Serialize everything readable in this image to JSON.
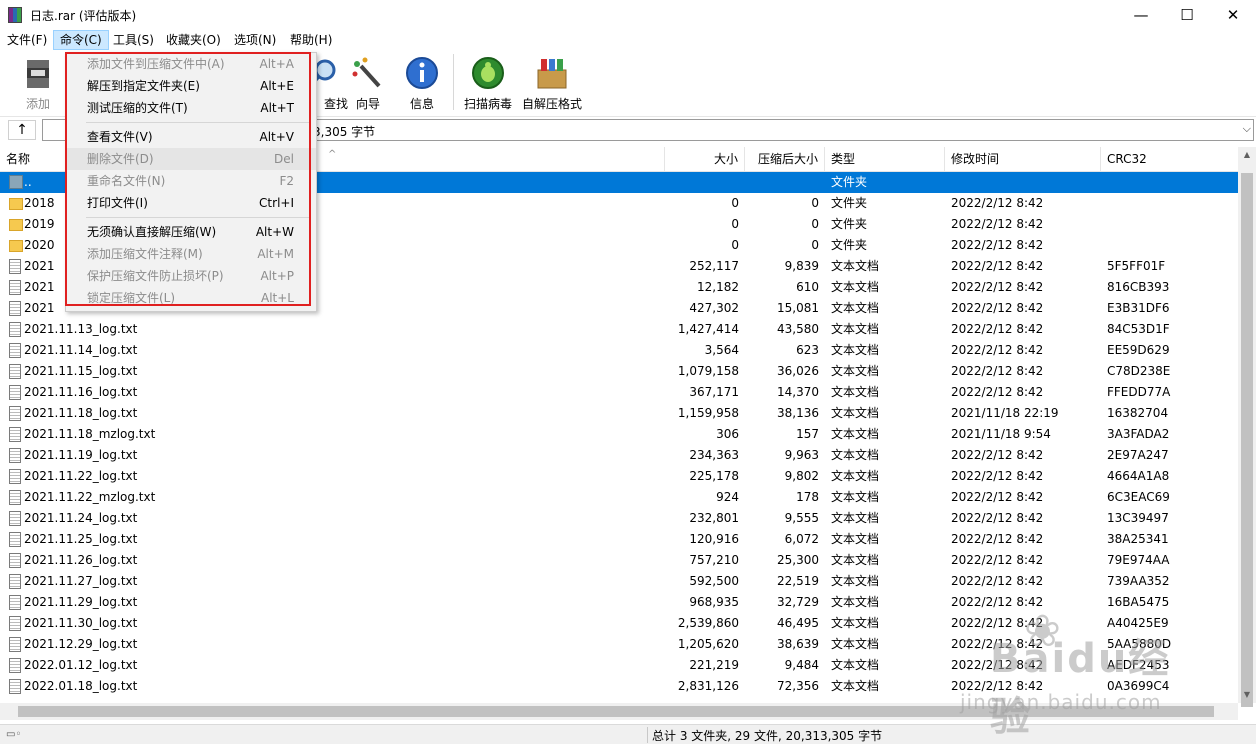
{
  "window": {
    "title": "日志.rar (评估版本)",
    "minimize": "—",
    "maximize": "☐",
    "close": "✕"
  },
  "menubar": {
    "items": [
      "文件(F)",
      "命令(C)",
      "工具(S)",
      "收藏夹(O)",
      "选项(N)",
      "帮助(H)"
    ],
    "active_index": 1
  },
  "toolbar": {
    "items": [
      {
        "label": "添加",
        "icon": "add-archive-icon"
      },
      {
        "label": "查找",
        "icon": "find-icon"
      },
      {
        "label": "向导",
        "icon": "wizard-icon"
      },
      {
        "label": "信息",
        "icon": "info-icon"
      },
      {
        "label": "扫描病毒",
        "icon": "virus-scan-icon"
      },
      {
        "label": "自解压格式",
        "icon": "sfx-icon"
      }
    ]
  },
  "addressbar": {
    "up": "↑",
    "path_fragment": "3,305 字节"
  },
  "list": {
    "columns": {
      "name": "名称",
      "size": "大小",
      "packed": "压缩后大小",
      "type": "类型",
      "modified": "修改时间",
      "crc": "CRC32"
    },
    "rows": [
      {
        "icon": "parent",
        "name": "..",
        "size": "",
        "packed": "",
        "type": "文件夹",
        "modified": "",
        "crc": ""
      },
      {
        "icon": "folder",
        "name": "2018",
        "size": "0",
        "packed": "0",
        "type": "文件夹",
        "modified": "2022/2/12 8:42",
        "crc": ""
      },
      {
        "icon": "folder",
        "name": "2019",
        "size": "0",
        "packed": "0",
        "type": "文件夹",
        "modified": "2022/2/12 8:42",
        "crc": ""
      },
      {
        "icon": "folder",
        "name": "2020",
        "size": "0",
        "packed": "0",
        "type": "文件夹",
        "modified": "2022/2/12 8:42",
        "crc": ""
      },
      {
        "icon": "txt",
        "name": "2021",
        "size": "252,117",
        "packed": "9,839",
        "type": "文本文档",
        "modified": "2022/2/12 8:42",
        "crc": "5F5FF01F"
      },
      {
        "icon": "txt",
        "name": "2021",
        "size": "12,182",
        "packed": "610",
        "type": "文本文档",
        "modified": "2022/2/12 8:42",
        "crc": "816CB393"
      },
      {
        "icon": "txt",
        "name": "2021",
        "size": "427,302",
        "packed": "15,081",
        "type": "文本文档",
        "modified": "2022/2/12 8:42",
        "crc": "E3B31DF6"
      },
      {
        "icon": "txt",
        "name": "2021.11.13_log.txt",
        "size": "1,427,414",
        "packed": "43,580",
        "type": "文本文档",
        "modified": "2022/2/12 8:42",
        "crc": "84C53D1F"
      },
      {
        "icon": "txt",
        "name": "2021.11.14_log.txt",
        "size": "3,564",
        "packed": "623",
        "type": "文本文档",
        "modified": "2022/2/12 8:42",
        "crc": "EE59D629"
      },
      {
        "icon": "txt",
        "name": "2021.11.15_log.txt",
        "size": "1,079,158",
        "packed": "36,026",
        "type": "文本文档",
        "modified": "2022/2/12 8:42",
        "crc": "C78D238E"
      },
      {
        "icon": "txt",
        "name": "2021.11.16_log.txt",
        "size": "367,171",
        "packed": "14,370",
        "type": "文本文档",
        "modified": "2022/2/12 8:42",
        "crc": "FFEDD77A"
      },
      {
        "icon": "txt",
        "name": "2021.11.18_log.txt",
        "size": "1,159,958",
        "packed": "38,136",
        "type": "文本文档",
        "modified": "2021/11/18 22:19",
        "crc": "16382704"
      },
      {
        "icon": "txt",
        "name": "2021.11.18_mzlog.txt",
        "size": "306",
        "packed": "157",
        "type": "文本文档",
        "modified": "2021/11/18 9:54",
        "crc": "3A3FADA2"
      },
      {
        "icon": "txt",
        "name": "2021.11.19_log.txt",
        "size": "234,363",
        "packed": "9,963",
        "type": "文本文档",
        "modified": "2022/2/12 8:42",
        "crc": "2E97A247"
      },
      {
        "icon": "txt",
        "name": "2021.11.22_log.txt",
        "size": "225,178",
        "packed": "9,802",
        "type": "文本文档",
        "modified": "2022/2/12 8:42",
        "crc": "4664A1A8"
      },
      {
        "icon": "txt",
        "name": "2021.11.22_mzlog.txt",
        "size": "924",
        "packed": "178",
        "type": "文本文档",
        "modified": "2022/2/12 8:42",
        "crc": "6C3EAC69"
      },
      {
        "icon": "txt",
        "name": "2021.11.24_log.txt",
        "size": "232,801",
        "packed": "9,555",
        "type": "文本文档",
        "modified": "2022/2/12 8:42",
        "crc": "13C39497"
      },
      {
        "icon": "txt",
        "name": "2021.11.25_log.txt",
        "size": "120,916",
        "packed": "6,072",
        "type": "文本文档",
        "modified": "2022/2/12 8:42",
        "crc": "38A25341"
      },
      {
        "icon": "txt",
        "name": "2021.11.26_log.txt",
        "size": "757,210",
        "packed": "25,300",
        "type": "文本文档",
        "modified": "2022/2/12 8:42",
        "crc": "79E974AA"
      },
      {
        "icon": "txt",
        "name": "2021.11.27_log.txt",
        "size": "592,500",
        "packed": "22,519",
        "type": "文本文档",
        "modified": "2022/2/12 8:42",
        "crc": "739AA352"
      },
      {
        "icon": "txt",
        "name": "2021.11.29_log.txt",
        "size": "968,935",
        "packed": "32,729",
        "type": "文本文档",
        "modified": "2022/2/12 8:42",
        "crc": "16BA5475"
      },
      {
        "icon": "txt",
        "name": "2021.11.30_log.txt",
        "size": "2,539,860",
        "packed": "46,495",
        "type": "文本文档",
        "modified": "2022/2/12 8:42",
        "crc": "A40425E9"
      },
      {
        "icon": "txt",
        "name": "2021.12.29_log.txt",
        "size": "1,205,620",
        "packed": "38,639",
        "type": "文本文档",
        "modified": "2022/2/12 8:42",
        "crc": "5AA5880D"
      },
      {
        "icon": "txt",
        "name": "2022.01.12_log.txt",
        "size": "221,219",
        "packed": "9,484",
        "type": "文本文档",
        "modified": "2022/2/12 8:42",
        "crc": "AEDF2453"
      },
      {
        "icon": "txt",
        "name": "2022.01.18_log.txt",
        "size": "2,831,126",
        "packed": "72,356",
        "type": "文本文档",
        "modified": "2022/2/12 8:42",
        "crc": "0A3699C4"
      }
    ]
  },
  "dropdown": {
    "items": [
      {
        "label": "添加文件到压缩文件中(A)",
        "shortcut": "Alt+A",
        "disabled": true
      },
      {
        "label": "解压到指定文件夹(E)",
        "shortcut": "Alt+E",
        "disabled": false
      },
      {
        "label": "测试压缩的文件(T)",
        "shortcut": "Alt+T",
        "disabled": false
      },
      {
        "sep": true
      },
      {
        "label": "查看文件(V)",
        "shortcut": "Alt+V",
        "disabled": false
      },
      {
        "label": "删除文件(D)",
        "shortcut": "Del",
        "disabled": true,
        "hover": true
      },
      {
        "label": "重命名文件(N)",
        "shortcut": "F2",
        "disabled": true
      },
      {
        "label": "打印文件(I)",
        "shortcut": "Ctrl+I",
        "disabled": false
      },
      {
        "sep": true
      },
      {
        "label": "无须确认直接解压缩(W)",
        "shortcut": "Alt+W",
        "disabled": false
      },
      {
        "label": "添加压缩文件注释(M)",
        "shortcut": "Alt+M",
        "disabled": true
      },
      {
        "label": "保护压缩文件防止损坏(P)",
        "shortcut": "Alt+P",
        "disabled": true
      },
      {
        "label": "锁定压缩文件(L)",
        "shortcut": "Alt+L",
        "disabled": true
      }
    ]
  },
  "status": {
    "text": "总计 3 文件夹, 29 文件, 20,313,305 字节"
  },
  "watermark": {
    "big": "Baidu经验",
    "small": "jingyan.baidu.com"
  },
  "colors": {
    "selection": "#0078d7",
    "highlight_box": "#e02020",
    "menu_active": "#cce8ff"
  }
}
